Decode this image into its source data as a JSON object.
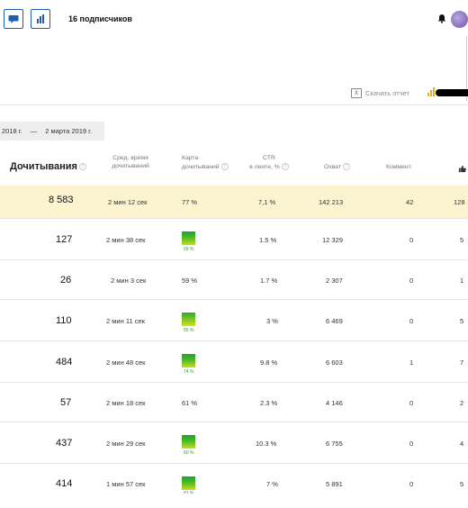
{
  "header": {
    "subscribers": "16 подписчиков",
    "icons": [
      "comment-bubble-icon",
      "bar-chart-icon",
      "bell-icon"
    ],
    "accent": "#1f5fb0"
  },
  "toolbar": {
    "report_label": "Скачать отчет",
    "excel_badge": "X"
  },
  "date_range": {
    "from": "2018 г.",
    "sep": "—",
    "to": "2 марта 2019 г."
  },
  "table": {
    "headers": {
      "reads": "Дочитывания",
      "avg_time": "Сред. время дочитываний",
      "avg_time_l1": "Сред. время",
      "avg_time_l2": "дочитываний",
      "map_l1": "Карта",
      "map_l2": "дочитываний",
      "ctr_l1": "CTR",
      "ctr_l2": "в ленте, %",
      "reach": "Охват",
      "comments": "Коммент.",
      "help": "?"
    },
    "total": {
      "reads": "8 583",
      "avg_time": "2 мин 12 сек",
      "map": "77 %",
      "ctr": "7,1 %",
      "reach": "142 213",
      "comments": "42",
      "likes": "128"
    },
    "rows": [
      {
        "reads": "127",
        "avg_time": "2 мин 38 сек",
        "map_pct": "69 %",
        "ctr": "1.5 %",
        "reach": "12 329",
        "comments": "0",
        "likes": "5"
      },
      {
        "reads": "26",
        "avg_time": "2 мин 3 сек",
        "map_text": "59 %",
        "ctr": "1.7 %",
        "reach": "2 307",
        "comments": "0",
        "likes": "1"
      },
      {
        "reads": "110",
        "avg_time": "2 мин 11 сек",
        "map_pct": "55 %",
        "ctr": "3 %",
        "reach": "6 469",
        "comments": "0",
        "likes": "5"
      },
      {
        "reads": "484",
        "avg_time": "2 мин 48 сек",
        "map_pct": "74 %",
        "ctr": "9.8 %",
        "reach": "6 603",
        "comments": "1",
        "likes": "7"
      },
      {
        "reads": "57",
        "avg_time": "2 мин 18 сек",
        "map_text": "61 %",
        "ctr": "2.3 %",
        "reach": "4 146",
        "comments": "0",
        "likes": "2"
      },
      {
        "reads": "437",
        "avg_time": "2 мин 29 сек",
        "map_pct": "60 %",
        "ctr": "10.3 %",
        "reach": "6 755",
        "comments": "0",
        "likes": "4"
      },
      {
        "reads": "414",
        "avg_time": "1 мин 57 сек",
        "map_pct": "81 %",
        "ctr": "7 %",
        "reach": "5 891",
        "comments": "0",
        "likes": "5"
      }
    ]
  },
  "colors": {
    "total_row": "#fcf4cf",
    "map_green": "#1aa329",
    "map_yellow": "#d9e21b"
  }
}
